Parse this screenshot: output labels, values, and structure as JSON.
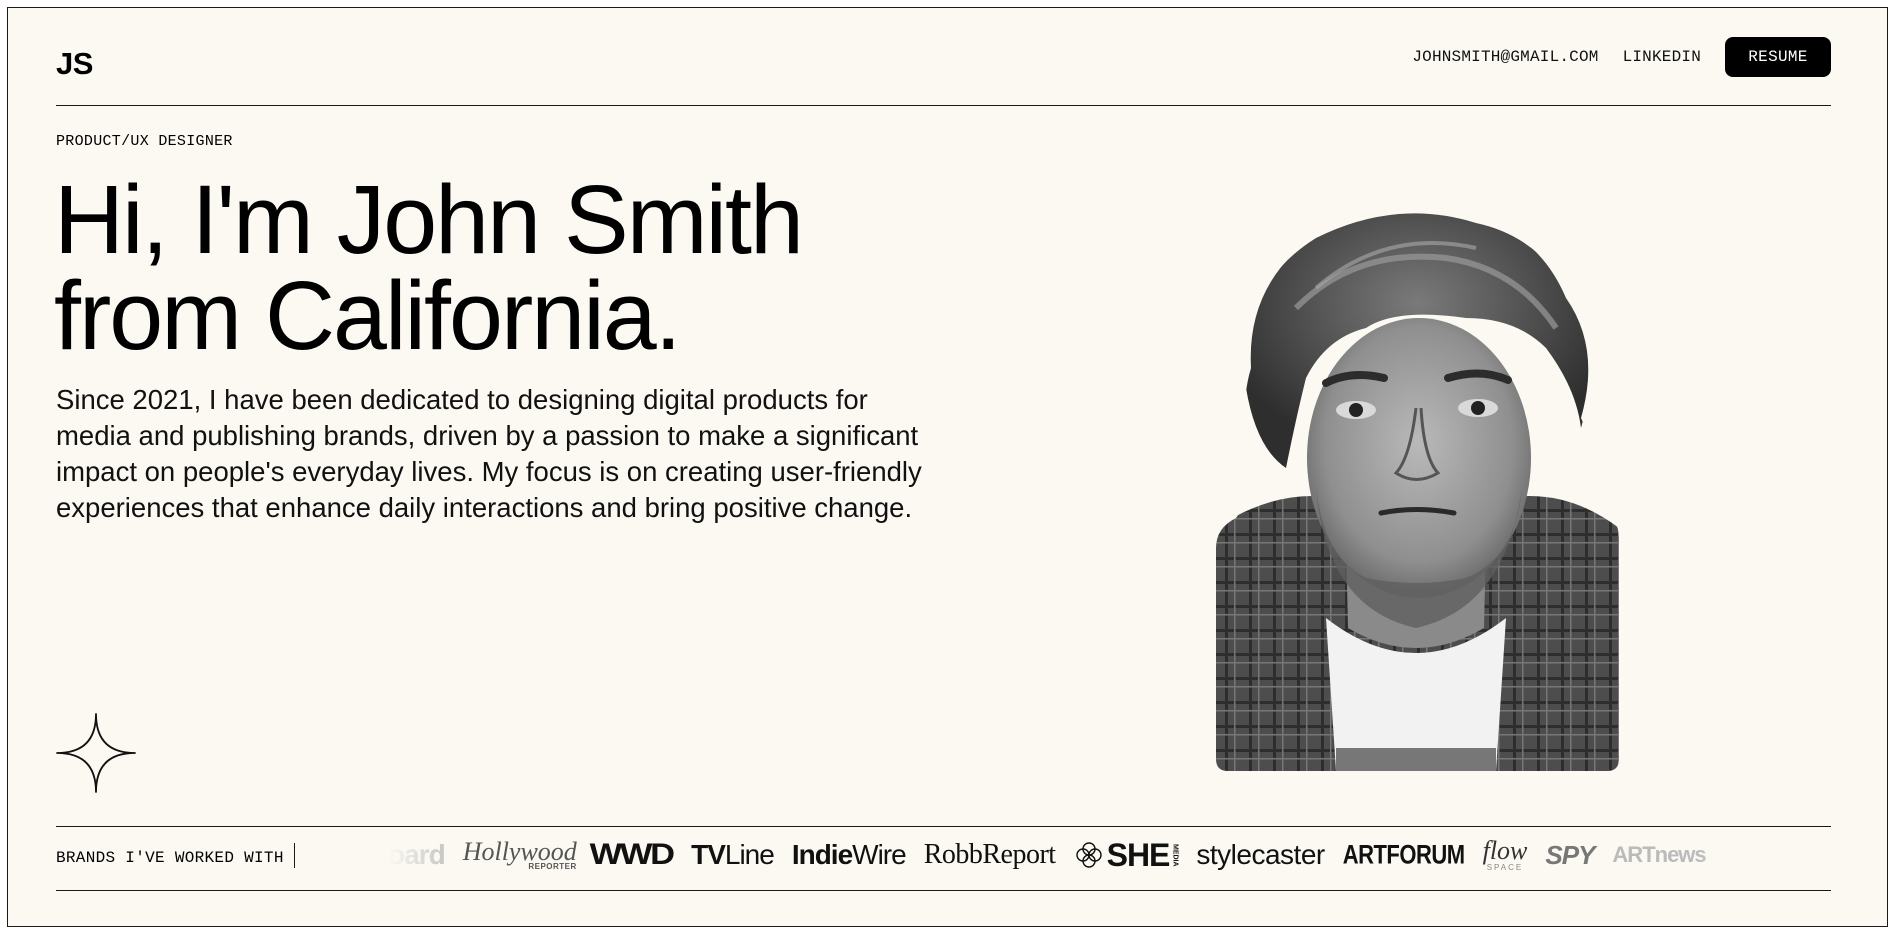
{
  "header": {
    "logo": "JS",
    "nav": {
      "email": "JOHNSMITH@GMAIL.COM",
      "linkedin": "LINKEDIN",
      "resume": "RESUME"
    }
  },
  "hero": {
    "role": "PRODUCT/UX DESIGNER",
    "headline_line1": "Hi, I'm John Smith",
    "headline_line2": "from California.",
    "intro": "Since 2021, I have been dedicated to designing digital products for media and publishing brands, driven by a passion to make a significant impact on people's everyday lives. My focus is on creating user-friendly experiences that enhance daily interactions and bring positive change."
  },
  "icons": {
    "decor": "four-point-star-icon",
    "portrait": "portrait-photo"
  },
  "brands": {
    "label": "BRANDS I'VE WORKED WITH",
    "items": [
      {
        "name": "oard"
      },
      {
        "name": "Hollywood",
        "sub": "REPORTER"
      },
      {
        "name": "WWD"
      },
      {
        "name_bold": "TV",
        "name_light": "Line"
      },
      {
        "name_bold": "Indie",
        "name_light": "Wire"
      },
      {
        "name": "RobbReport"
      },
      {
        "name": "SHE",
        "sub": "MEDIA"
      },
      {
        "name": "stylecaster"
      },
      {
        "name": "ARTFORUM"
      },
      {
        "name": "flow",
        "sub": "SPACE"
      },
      {
        "name": "SPY"
      },
      {
        "name": "ARTnews"
      }
    ]
  },
  "colors": {
    "background": "#fbf9f2",
    "text": "#000000",
    "button_bg": "#000000",
    "button_text": "#ffffff"
  }
}
